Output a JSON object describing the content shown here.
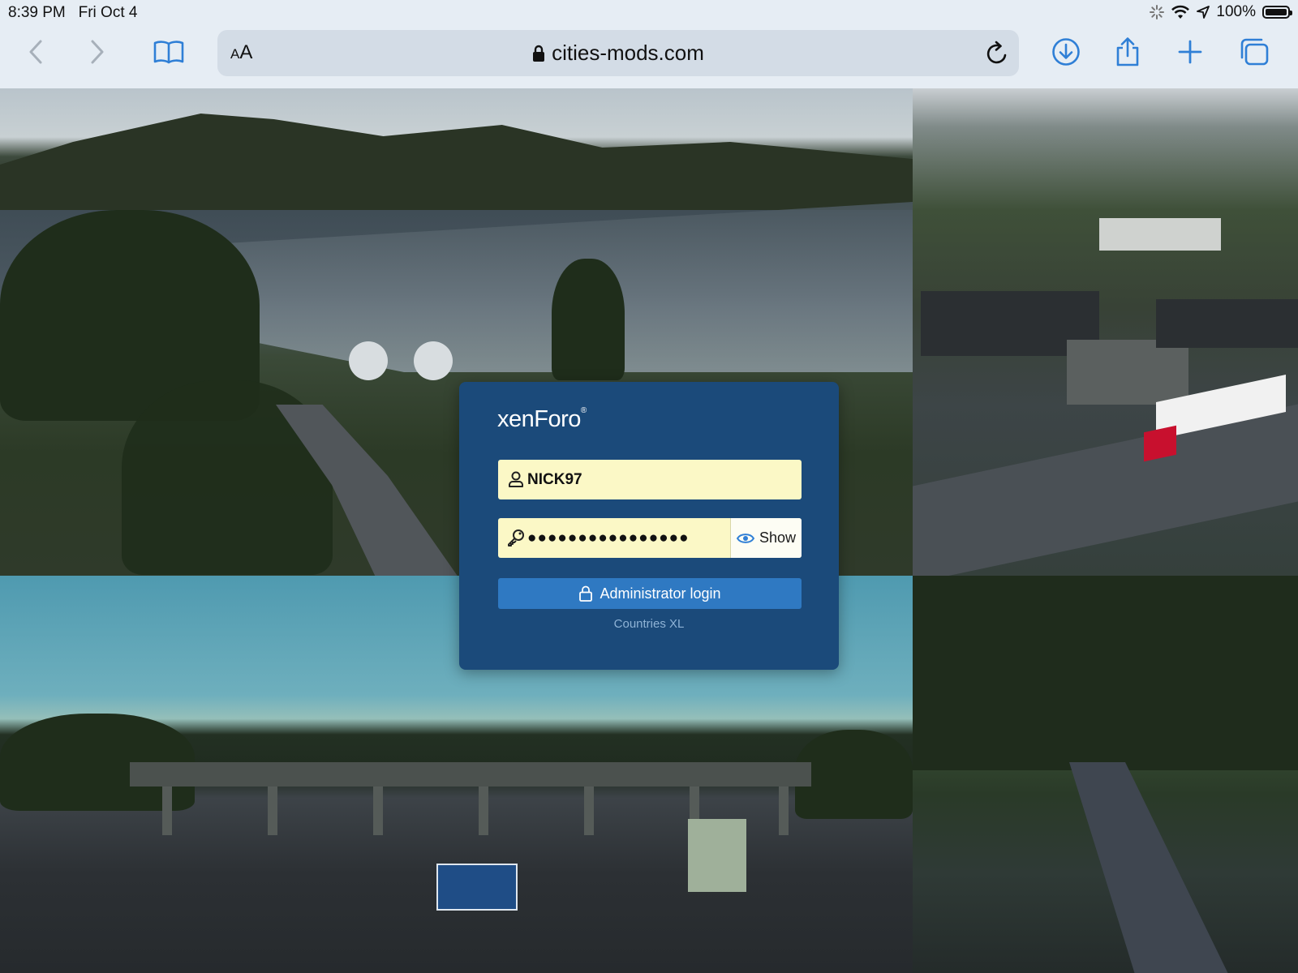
{
  "status_bar": {
    "time": "8:39 PM",
    "date": "Fri Oct 4",
    "battery_percent": "100%"
  },
  "browser": {
    "text_size_label_small": "A",
    "text_size_label_large": "A",
    "url": "cities-mods.com",
    "icons": {
      "back": "chevron-left-icon",
      "forward": "chevron-right-icon",
      "bookmarks": "book-icon",
      "reload": "reload-icon",
      "downloads": "download-icon",
      "share": "share-icon",
      "new_tab": "plus-icon",
      "tabs": "tabs-icon"
    }
  },
  "login": {
    "logo_text": "xenForo",
    "logo_mark": "®",
    "username_value": "NICK97",
    "password_value": "●●●●●●●●●●●●●●●●",
    "show_label": "Show",
    "submit_label": "Administrator login",
    "site_name": "Countries XL"
  },
  "colors": {
    "card_background": "#1b4a7a",
    "field_background": "#fbf8c6",
    "button_background": "#2f79c2",
    "browser_tint": "#2f7fd6"
  }
}
